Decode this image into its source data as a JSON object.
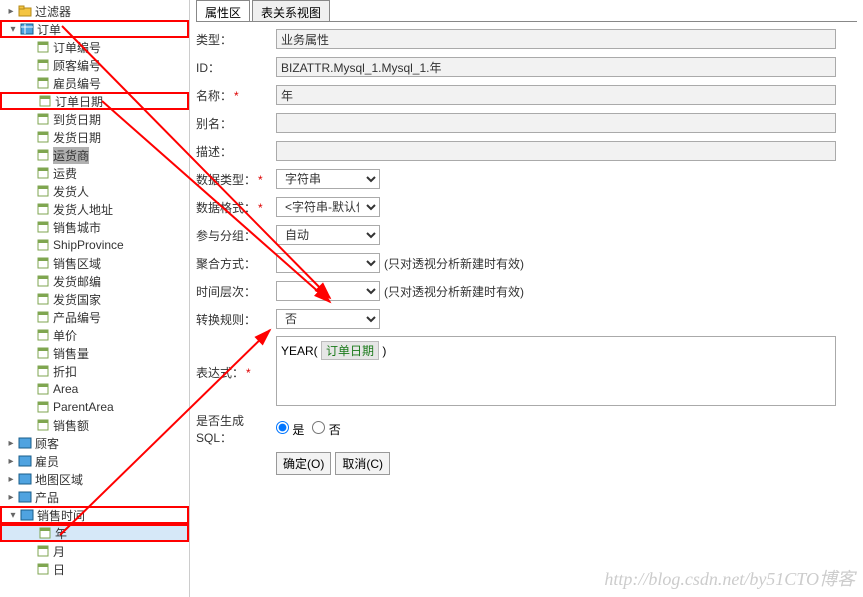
{
  "tree": {
    "filter": "过滤器",
    "order": "订单",
    "order_children": [
      "订单编号",
      "顾客编号",
      "雇员编号",
      "订单日期",
      "到货日期",
      "发货日期",
      "运货商",
      "运费",
      "发货人",
      "发货人地址",
      "销售城市",
      "ShipProvince",
      "销售区域",
      "发货邮编",
      "发货国家",
      "产品编号",
      "单价",
      "销售量",
      "折扣",
      "Area",
      "ParentArea",
      "销售额"
    ],
    "customer": "顾客",
    "employee": "雇员",
    "map_region": "地图区域",
    "product": "产品",
    "sale_time": "销售时间",
    "sale_time_children": [
      "年",
      "月",
      "日"
    ]
  },
  "tabs": {
    "props": "属性区",
    "relation": "表关系视图"
  },
  "form": {
    "type_label": "类型：",
    "type_value": "业务属性",
    "id_label": "ID：",
    "id_value": "BIZATTR.Mysql_1.Mysql_1.年",
    "name_label": "名称：",
    "name_value": "年",
    "alias_label": "别名：",
    "alias_value": "",
    "desc_label": "描述：",
    "desc_value": "",
    "dtype_label": "数据类型：",
    "dtype_value": "字符串",
    "dformat_label": "数据格式：",
    "dformat_value": "<字符串-默认值>",
    "group_label": "参与分组：",
    "group_value": "自动",
    "agg_label": "聚合方式：",
    "agg_value": "",
    "agg_hint": "(只对透视分析新建时有效)",
    "time_label": "时间层次：",
    "time_value": "",
    "time_hint": "(只对透视分析新建时有效)",
    "conv_label": "转换规则：",
    "conv_value": "否",
    "expr_label": "表达式：",
    "expr_func": "YEAR(",
    "expr_field": "订单日期",
    "expr_close": ")",
    "sql_label": "是否生成SQL：",
    "sql_yes": "是",
    "sql_no": "否",
    "btn_ok": "确定(O)",
    "btn_cancel": "取消(C)"
  },
  "watermark": "http://blog.csdn.net/by51CTO博客"
}
